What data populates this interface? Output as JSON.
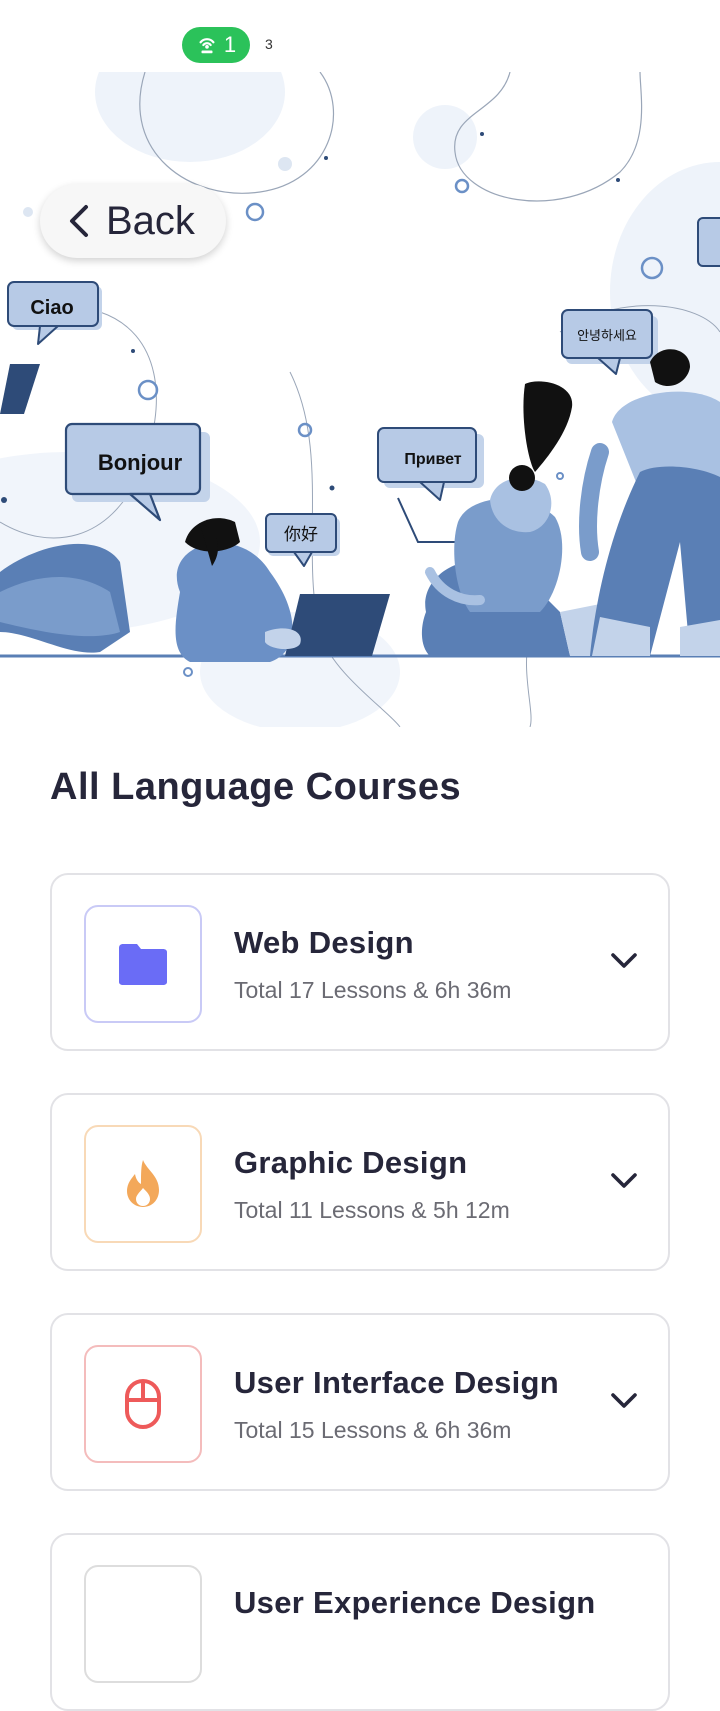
{
  "status_bar": {
    "hotspot_count": "1",
    "extra_count": "3",
    "colors": {
      "pill": "#2bc25a"
    }
  },
  "hero": {
    "back_label": "Back",
    "bubbles": {
      "ciao": "Ciao",
      "bonjour": "Bonjour",
      "nihao": "你好",
      "privet": "Привет",
      "annyeong": "안녕하세요"
    },
    "colors": {
      "primary": "#6b90c6",
      "light": "#a9c1e2",
      "dark": "#2e4b78",
      "bubble": "#c3d3ea"
    }
  },
  "section": {
    "title": "All Language Courses"
  },
  "courses": [
    {
      "title": "Web Design",
      "subtitle": "Total 17 Lessons & 6h 36m",
      "icon": "folder-icon",
      "color": "#6a6cf6",
      "border": "#c9caf6"
    },
    {
      "title": "Graphic Design",
      "subtitle": "Total 11 Lessons & 5h 12m",
      "icon": "flame-icon",
      "color": "#f3a85a",
      "border": "#f8d9b7"
    },
    {
      "title": "User Interface Design",
      "subtitle": "Total 15 Lessons & 6h 36m",
      "icon": "mouse-icon",
      "color": "#ee5a5a",
      "border": "#f4bcbc"
    },
    {
      "title": "User Experience Design",
      "subtitle": "",
      "icon": "",
      "color": "#cccccc",
      "border": "#dddddd"
    }
  ]
}
